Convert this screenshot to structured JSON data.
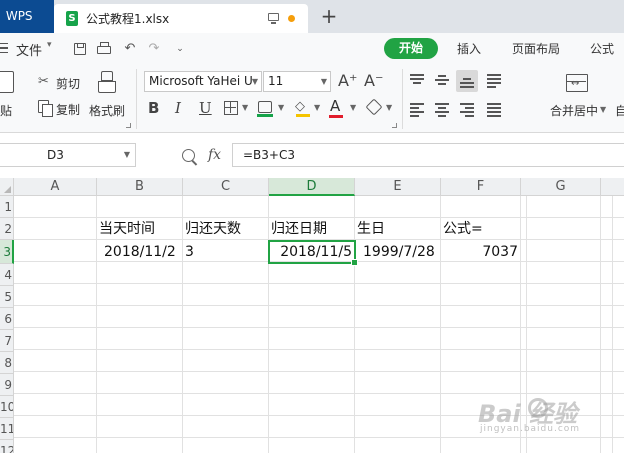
{
  "titlebar": {
    "app_tab": "WPS",
    "file_tab": "公式教程1.xlsx",
    "file_icon_letter": "S",
    "new_tab": "+"
  },
  "menubar": {
    "file_menu": "文件",
    "quick_access": {
      "undo": "↶",
      "redo": "↷",
      "more": "⌄"
    },
    "tabs": [
      {
        "label": "开始",
        "active": true
      },
      {
        "label": "插入"
      },
      {
        "label": "页面布局"
      },
      {
        "label": "公式"
      }
    ]
  },
  "ribbon": {
    "paste_label": "粘贴",
    "cut_label": "剪切",
    "copy_label": "复制",
    "format_painter_label": "格式刷",
    "font_name": "Microsoft YaHei U",
    "font_size": "11",
    "grow_font": "A⁺",
    "shrink_font": "A⁻",
    "bold": "B",
    "italic": "I",
    "underline": "U",
    "font_color_glyph": "A",
    "merge_center_label": "合并居中",
    "more_label": "自",
    "accent_green": "#21a344",
    "font_color": "#e11d2c",
    "highlight_color": "#f5c400"
  },
  "formulabar": {
    "name_box": "D3",
    "fx": "fx",
    "formula": "=B3+C3"
  },
  "sheet": {
    "columns": [
      "A",
      "B",
      "C",
      "D",
      "E",
      "F",
      "G"
    ],
    "selected_column": "D",
    "rows": [
      "1",
      "2",
      "3",
      "4",
      "5",
      "6",
      "7",
      "8",
      "9",
      "10",
      "11",
      "12"
    ],
    "selected_row": "3",
    "row2": {
      "B": "当天时间",
      "C": "归还天数",
      "D": "归还日期",
      "E": "生日",
      "F": "公式="
    },
    "row3": {
      "B": "2018/11/2",
      "C": "3",
      "D": "2018/11/5",
      "E": "1999/7/28",
      "F": "7037"
    }
  },
  "watermark": {
    "logo": "Bai  经验",
    "sub": "jingyan.baidu.com"
  }
}
